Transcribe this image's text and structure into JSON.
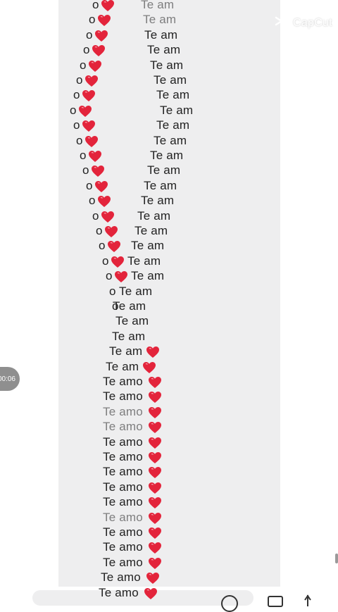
{
  "watermark": {
    "text": "CapCut",
    "icon": "capcut-logo-icon"
  },
  "timer": {
    "text": "00:06"
  },
  "colors": {
    "heart": "#e3243b",
    "chat_bg": "#eeeeef",
    "text": "#222222"
  },
  "lines": [
    {
      "o": "o",
      "heart": true,
      "text": "Te am",
      "ghost": true
    },
    {
      "o": "o",
      "heart": true,
      "text": "Te am",
      "ghost": true
    },
    {
      "o": "o",
      "heart": true,
      "text": "Te am"
    },
    {
      "o": "o",
      "heart": true,
      "text": "Te am"
    },
    {
      "o": "o",
      "heart": true,
      "text": "Te am"
    },
    {
      "o": "o",
      "heart": true,
      "text": "Te am"
    },
    {
      "o": "o",
      "heart": true,
      "text": "Te am"
    },
    {
      "o": "o",
      "heart": true,
      "text": "Te am"
    },
    {
      "o": "o",
      "heart": true,
      "text": "Te am"
    },
    {
      "o": "o",
      "heart": true,
      "text": "Te am"
    },
    {
      "o": "o",
      "heart": true,
      "text": "Te am"
    },
    {
      "o": "o",
      "heart": true,
      "text": "Te am"
    },
    {
      "o": "o",
      "heart": true,
      "text": "Te am"
    },
    {
      "o": "o",
      "heart": true,
      "text": "Te am"
    },
    {
      "o": "o",
      "heart": true,
      "text": "Te am"
    },
    {
      "o": "o",
      "heart": true,
      "text": "Te am"
    },
    {
      "o": "o",
      "heart": true,
      "text": "Te am"
    },
    {
      "o": "o",
      "heart": true,
      "text": "Te am"
    },
    {
      "o": "o",
      "heart": true,
      "text": "Te am"
    },
    {
      "o": "o",
      "heart": false,
      "text": "Te am"
    },
    {
      "o": "o",
      "heart": false,
      "text": "Te am"
    },
    {
      "o": "",
      "heart": false,
      "text": "Te am"
    },
    {
      "o": "",
      "heart": false,
      "text": "Te am"
    },
    {
      "o": "",
      "heart": false,
      "text": "Te am",
      "trail": true
    },
    {
      "o": "",
      "heart": false,
      "text": "Te am",
      "trail": true
    },
    {
      "o": "",
      "heart": false,
      "text": "Te amo",
      "trail": true
    },
    {
      "o": "",
      "heart": false,
      "text": "Te amo",
      "trail": true
    },
    {
      "o": "",
      "heart": false,
      "text": "Te amo",
      "trail": true,
      "ghost": true
    },
    {
      "o": "",
      "heart": false,
      "text": "Te amo",
      "trail": true,
      "ghost": true
    },
    {
      "o": "",
      "heart": false,
      "text": "Te amo",
      "trail": true
    },
    {
      "o": "",
      "heart": false,
      "text": "Te amo",
      "trail": true
    },
    {
      "o": "",
      "heart": false,
      "text": "Te amo",
      "trail": true
    },
    {
      "o": "",
      "heart": false,
      "text": "Te amo",
      "trail": true
    },
    {
      "o": "",
      "heart": false,
      "text": "Te amo",
      "trail": true
    },
    {
      "o": "",
      "heart": false,
      "text": "Te amo",
      "trail": true,
      "ghost": true
    },
    {
      "o": "",
      "heart": false,
      "text": "Te amo",
      "trail": true
    },
    {
      "o": "",
      "heart": false,
      "text": "Te amo",
      "trail": true
    },
    {
      "o": "",
      "heart": false,
      "text": "Te amo",
      "trail": true
    },
    {
      "o": "",
      "heart": false,
      "text": "Te amo",
      "trail": true
    },
    {
      "o": "",
      "heart": false,
      "text": "Te amo",
      "trail": true
    }
  ],
  "bottom": {
    "emoji_icon": "emoji-icon",
    "camera_icon": "camera-icon",
    "mic_icon": "mic-icon"
  }
}
